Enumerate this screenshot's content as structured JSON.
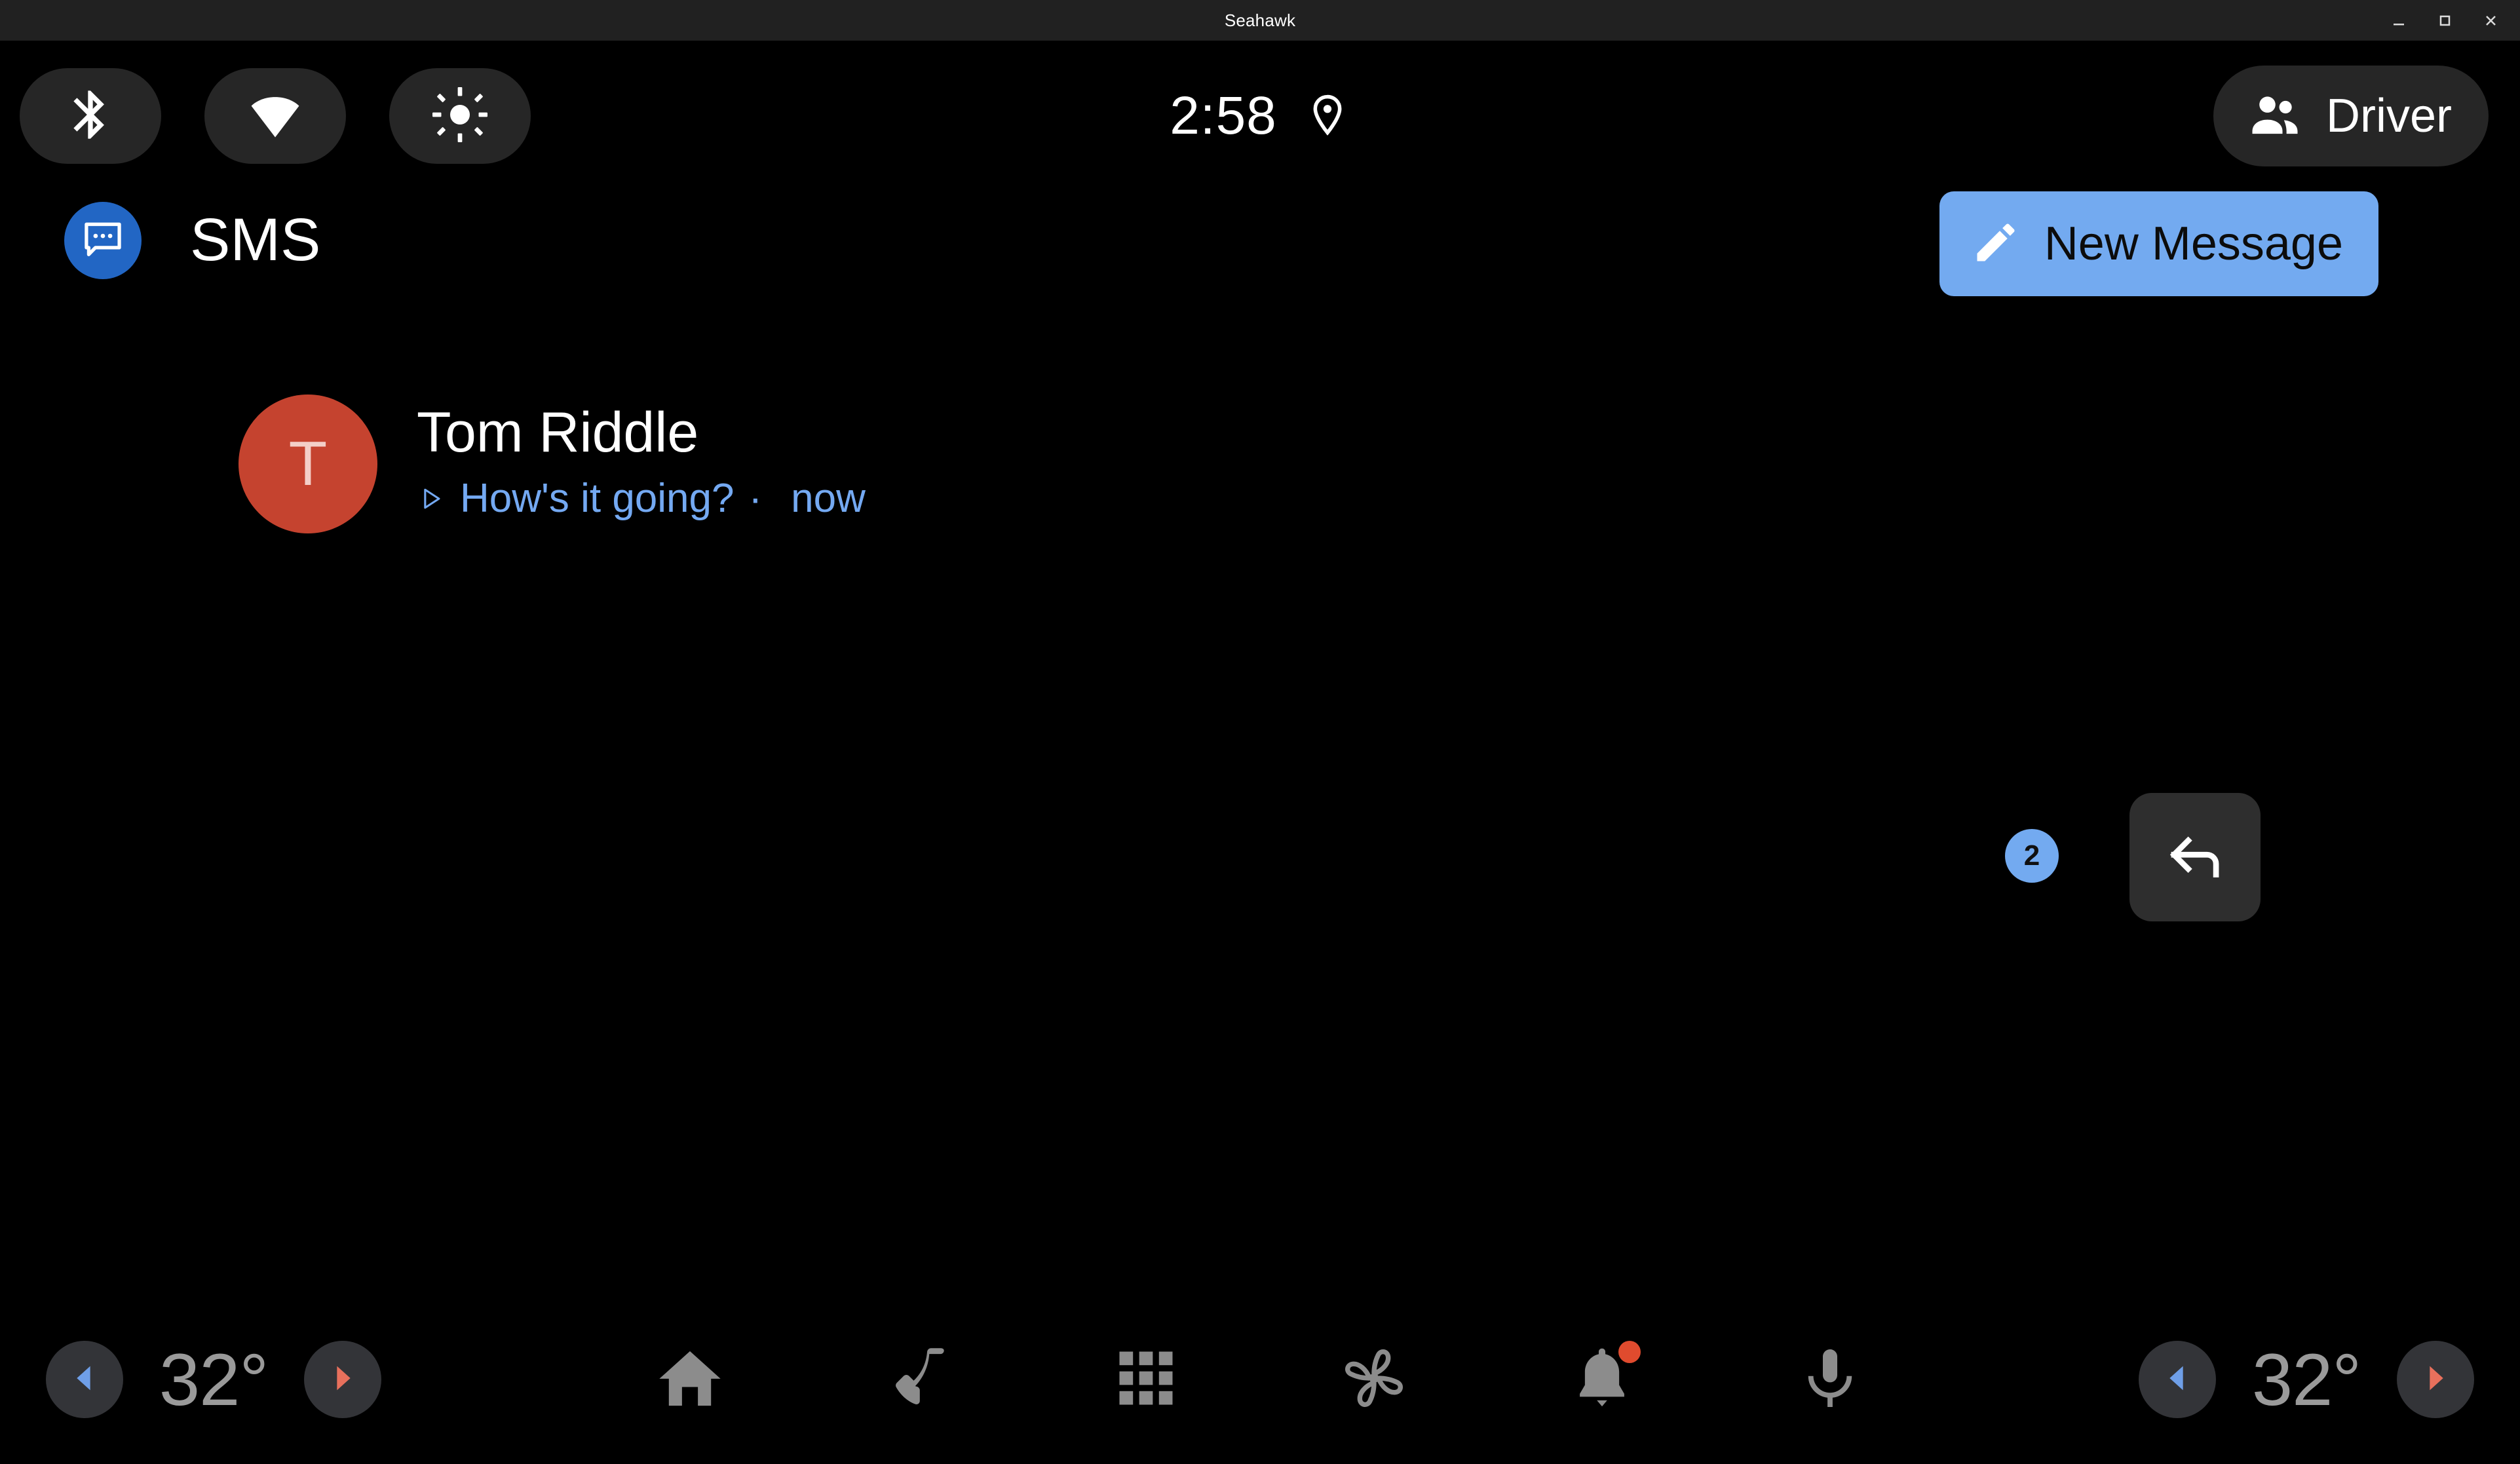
{
  "window": {
    "title": "Seahawk",
    "controls": [
      {
        "name": "minimize",
        "glyph": "minimize-icon"
      },
      {
        "name": "maximize",
        "glyph": "maximize-icon"
      },
      {
        "name": "close",
        "glyph": "close-icon"
      }
    ]
  },
  "status_bar": {
    "toggles": [
      {
        "id": "bluetooth",
        "icon": "bluetooth-icon"
      },
      {
        "id": "wifi",
        "icon": "wifi-icon"
      },
      {
        "id": "brightness",
        "icon": "brightness-icon"
      }
    ],
    "clock": "2:58",
    "location_icon": "location-pin-icon",
    "profile": {
      "label": "Driver",
      "icon": "people-icon"
    }
  },
  "app_header": {
    "icon": "sms-chat-bubble-icon",
    "title": "SMS",
    "new_message": {
      "label": "New Message",
      "icon": "pencil-icon"
    }
  },
  "conversations": [
    {
      "avatar_letter": "T",
      "avatar_color": "#c5432f",
      "name": "Tom Riddle",
      "preview_icon": "play-triangle-icon",
      "preview_text": "How's it going?",
      "separator": "·",
      "timestamp": "now",
      "unread_count": "2",
      "reply_icon": "reply-arrow-icon"
    }
  ],
  "bottom_bar": {
    "left_temp": {
      "decrease_icon": "chevron-left-icon",
      "value": "32°",
      "increase_icon": "chevron-right-icon"
    },
    "right_temp": {
      "decrease_icon": "chevron-left-icon",
      "value": "32°",
      "increase_icon": "chevron-right-icon"
    },
    "nav": [
      {
        "id": "home",
        "icon": "home-icon",
        "badge": false
      },
      {
        "id": "phone",
        "icon": "phone-icon",
        "badge": false
      },
      {
        "id": "apps",
        "icon": "apps-grid-icon",
        "badge": false
      },
      {
        "id": "climate",
        "icon": "fan-icon",
        "badge": false
      },
      {
        "id": "notifications",
        "icon": "bell-icon",
        "badge": true
      },
      {
        "id": "assistant",
        "icon": "microphone-icon",
        "badge": false
      }
    ]
  },
  "colors": {
    "background": "#000000",
    "titlebar": "#212121",
    "accent_blue": "#73aaf0",
    "app_blue": "#2266c4",
    "preview_blue": "#74a9f2",
    "avatar_red": "#c5432f",
    "pill_gray": "#262626",
    "nav_gray": "#8c8c8c",
    "temp_gray": "#9a9a9a",
    "cool_arrow": "#6f9fe8",
    "warm_arrow": "#e8705c",
    "badge_red": "#e04b2e"
  }
}
